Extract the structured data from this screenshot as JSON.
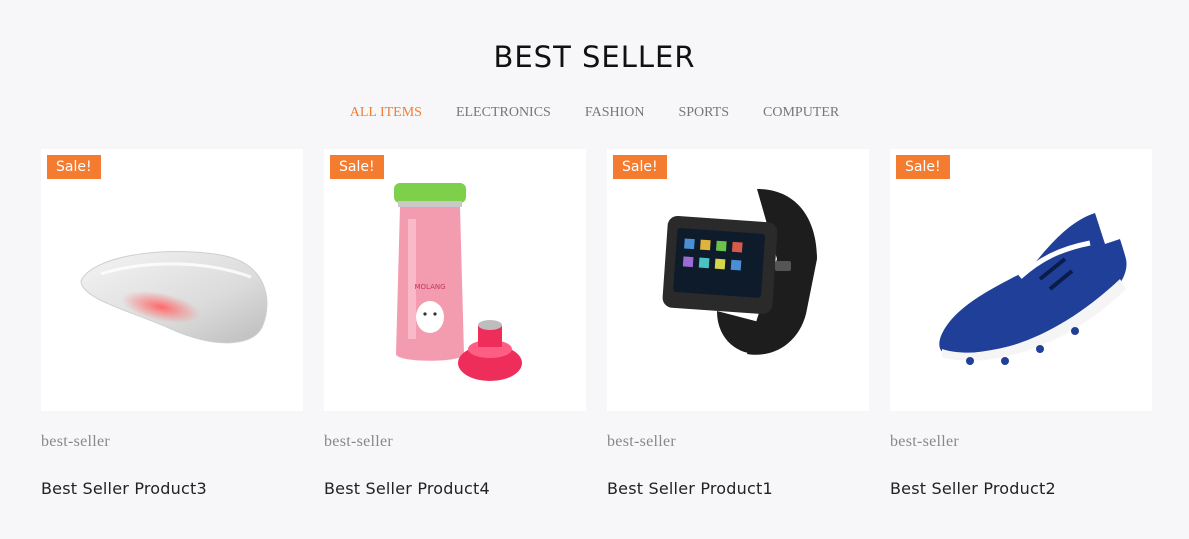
{
  "section": {
    "title": "BEST SELLER"
  },
  "tabs": [
    {
      "label": "ALL ITEMS",
      "active": true
    },
    {
      "label": "ELECTRONICS",
      "active": false
    },
    {
      "label": "FASHION",
      "active": false
    },
    {
      "label": "SPORTS",
      "active": false
    },
    {
      "label": "COMPUTER",
      "active": false
    }
  ],
  "products": [
    {
      "badge": "Sale!",
      "category": "best-seller",
      "name": "Best Seller Product3",
      "image": "mouse-image"
    },
    {
      "badge": "Sale!",
      "category": "best-seller",
      "name": "Best Seller Product4",
      "image": "thermos-image"
    },
    {
      "badge": "Sale!",
      "category": "best-seller",
      "name": "Best Seller Product1",
      "image": "smartwatch-image"
    },
    {
      "badge": "Sale!",
      "category": "best-seller",
      "name": "Best Seller Product2",
      "image": "soccer-shoe-image"
    }
  ],
  "colors": {
    "accent": "#f47c30",
    "background": "#f7f7f9"
  }
}
